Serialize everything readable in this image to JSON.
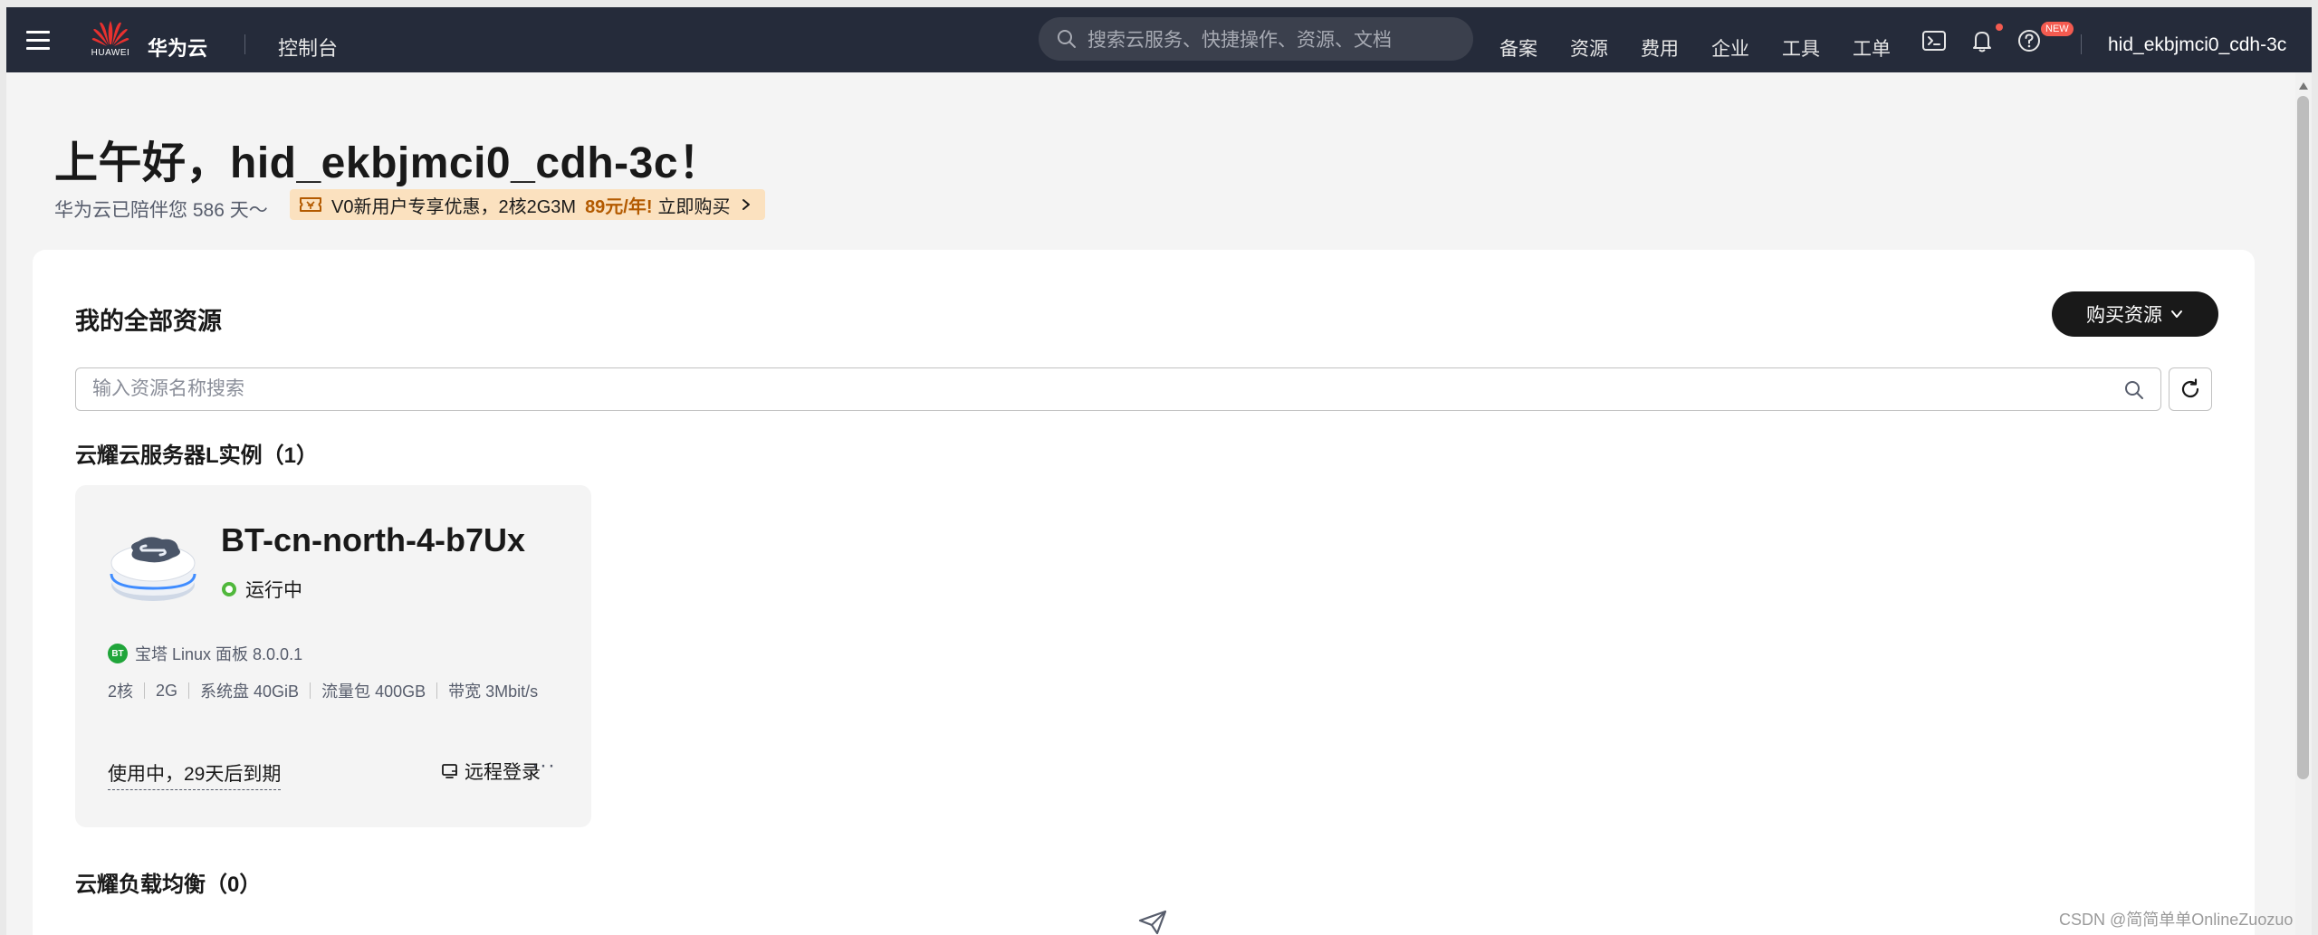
{
  "topbar": {
    "logo_text": "HUAWEI",
    "brand": "华为云",
    "console": "控制台",
    "search_placeholder": "搜索云服务、快捷操作、资源、文档",
    "links": [
      "备案",
      "资源",
      "费用",
      "企业",
      "工具",
      "工单"
    ],
    "new_badge": "NEW",
    "username": "hid_ekbjmci0_cdh-3c",
    "icons": [
      "menu-icon",
      "cloud-shell-icon",
      "bell-icon",
      "help-icon"
    ]
  },
  "greeting": {
    "title": "上午好，hid_ekbjmci0_cdh-3c！",
    "companion": "华为云已陪伴您 586 天～"
  },
  "promo": {
    "text": "V0新用户专享优惠，2核2G3M",
    "price": "89元/年!",
    "buy": "立即购买"
  },
  "resources": {
    "title": "我的全部资源",
    "buy_button": "购买资源",
    "search_placeholder": "输入资源名称搜索",
    "flexus_title": "云耀云服务器L实例（1）",
    "elb_title": "云耀负载均衡（0）"
  },
  "instance": {
    "name": "BT-cn-north-4-b7Ux",
    "status": "运行中",
    "status_color": "#50b83c",
    "image": "宝塔 Linux 面板 8.0.0.1",
    "image_badge": "BT",
    "specs": [
      "2核",
      "2G",
      "系统盘 40GiB",
      "流量包 400GB",
      "带宽 3Mbit/s"
    ],
    "expiry": "使用中，29天后到期",
    "remote_login": "远程登录",
    "more": "···"
  },
  "watermark": "CSDN @简简单单OnlineZuozuo",
  "colors": {
    "topbar_bg": "#252b3a",
    "promo_bg": "#fbe1bf",
    "price_color": "#b35a00",
    "button_bg": "#191919"
  }
}
